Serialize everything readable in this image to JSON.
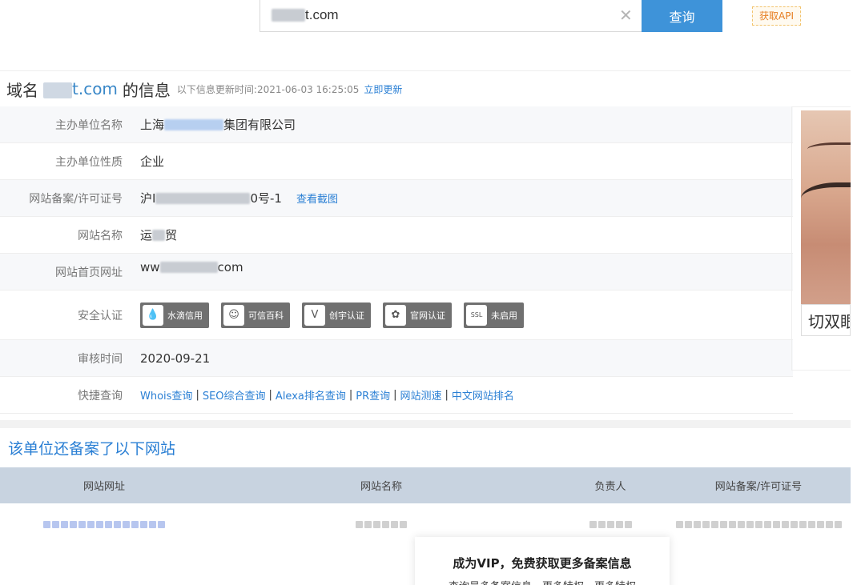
{
  "search": {
    "value": "t.com",
    "clear_icon": "✕",
    "button_label": "查询",
    "api_label": "获取API"
  },
  "title": {
    "prefix": "域名",
    "domain_visible": "t.com",
    "suffix": "的信息",
    "meta_label": "以下信息更新时间:",
    "meta_time": "2021-06-03 16:25:05",
    "update_link": "立即更新"
  },
  "info": {
    "sponsor": {
      "label": "主办单位名称",
      "value_start": "上海",
      "value_end": "集团有限公司"
    },
    "nature": {
      "label": "主办单位性质",
      "value": "企业"
    },
    "license": {
      "label": "网站备案/许可证号",
      "value_start": "沪I",
      "value_end": "0号-1",
      "link": "查看截图"
    },
    "site_name": {
      "label": "网站名称",
      "value_start": "运",
      "value_end": "贸"
    },
    "homepage": {
      "label": "网站首页网址",
      "value_start": "ww",
      "value_end": "com"
    },
    "security": {
      "label": "安全认证",
      "badges": [
        {
          "icon": "water-drop-icon",
          "glyph": "💧",
          "label": "水滴信用"
        },
        {
          "icon": "trust-icon",
          "glyph": "☺",
          "label": "可信百科"
        },
        {
          "icon": "v-icon",
          "glyph": "Ⓥ",
          "label": "创宇认证"
        },
        {
          "icon": "paw-icon",
          "glyph": "🐾",
          "label": "官网认证"
        },
        {
          "icon": "ssl-icon",
          "glyph": "🔒",
          "label": "未启用"
        }
      ]
    },
    "review": {
      "label": "审核时间",
      "value": "2020-09-21"
    },
    "quick": {
      "label": "快捷查询",
      "links": [
        "Whois查询",
        "SEO综合查询",
        "Alexa排名查询",
        "PR查询",
        "网站测速",
        "中文网站排名"
      ]
    }
  },
  "ad": {
    "text": "切双眼"
  },
  "sites": {
    "section_title": "该单位还备案了以下网站",
    "columns": [
      "网站网址",
      "网站名称",
      "负责人",
      "网站备案/许可证号"
    ]
  },
  "vip": {
    "title": "成为VIP，免费获取更多备案信息",
    "subtitle": "查询最多备案信息，更多特权，更多特权"
  },
  "colors": {
    "accent": "#3e93d9",
    "link": "#2a7fd4",
    "header_bg": "#c8d3e0"
  }
}
